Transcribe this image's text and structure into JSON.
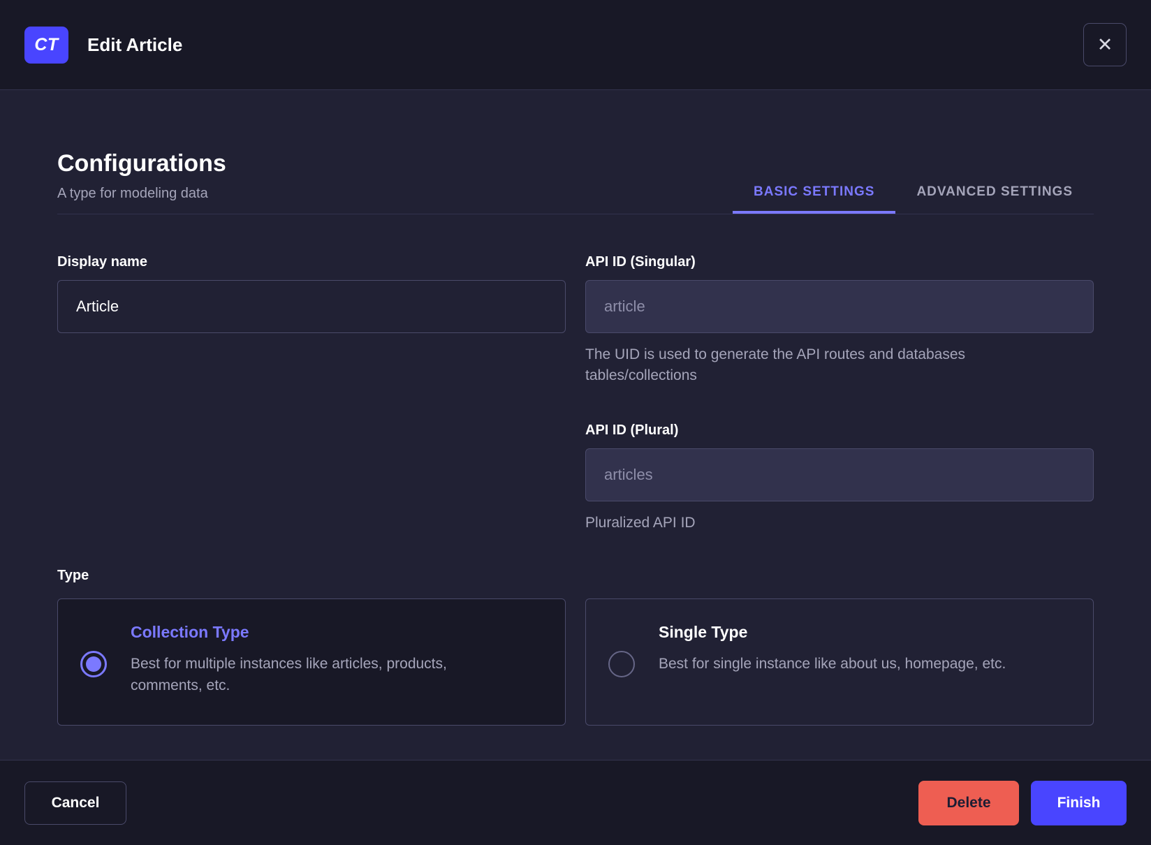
{
  "header": {
    "badge": "CT",
    "title": "Edit Article",
    "close_icon": "✕"
  },
  "configurations": {
    "title": "Configurations",
    "subtitle": "A type for modeling data"
  },
  "tabs": [
    {
      "label": "BASIC SETTINGS",
      "active": true
    },
    {
      "label": "ADVANCED SETTINGS",
      "active": false
    }
  ],
  "fields": {
    "display_name": {
      "label": "Display name",
      "value": "Article"
    },
    "api_id_singular": {
      "label": "API ID (Singular)",
      "value": "article",
      "hint": "The UID is used to generate the API routes and databases tables/collections"
    },
    "api_id_plural": {
      "label": "API ID (Plural)",
      "value": "articles",
      "hint": "Pluralized API ID"
    }
  },
  "type_section": {
    "label": "Type",
    "options": [
      {
        "title": "Collection Type",
        "description": "Best for multiple instances like articles, products, comments, etc.",
        "selected": true
      },
      {
        "title": "Single Type",
        "description": "Best for single instance like about us, homepage, etc.",
        "selected": false
      }
    ]
  },
  "footer": {
    "cancel_label": "Cancel",
    "delete_label": "Delete",
    "finish_label": "Finish"
  },
  "colors": {
    "primary": "#4945ff",
    "primary_light": "#7b79ff",
    "danger": "#ee5e52",
    "header_bg": "#181826",
    "body_bg": "#212134",
    "border": "#4a4a6a",
    "text_muted": "#a5a5ba"
  }
}
